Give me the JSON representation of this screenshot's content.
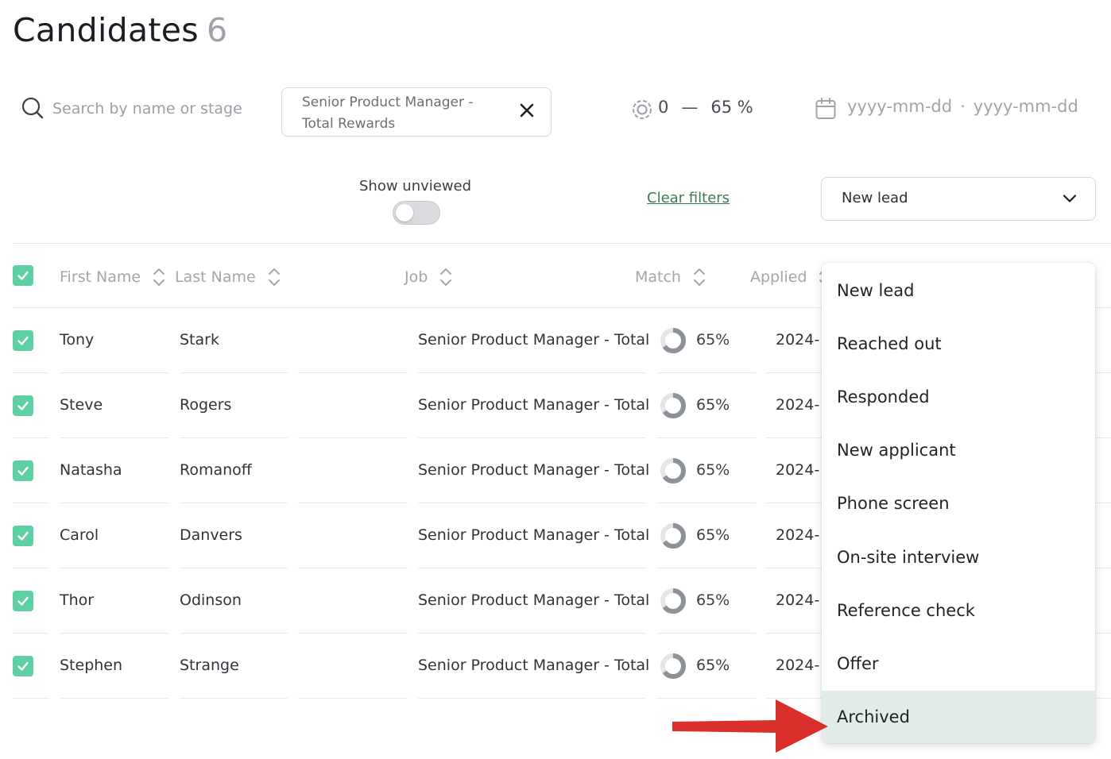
{
  "header": {
    "title": "Candidates",
    "count": "6"
  },
  "filters": {
    "search_placeholder": "Search by name or stage",
    "job_chip": "Senior Product Manager - Total Rewards",
    "match_min": "0",
    "match_dash": "—",
    "match_max": "65 %",
    "date_start_placeholder": "yyyy-mm-dd",
    "date_sep": "·",
    "date_end_placeholder": "yyyy-mm-dd",
    "show_unviewed_label": "Show unviewed",
    "show_unviewed_on": false,
    "clear_filters": "Clear filters",
    "stage_selected": "New lead"
  },
  "table": {
    "columns": [
      "First Name",
      "Last Name",
      "Job",
      "Match",
      "Applied"
    ],
    "rows": [
      {
        "first": "Tony",
        "last": "Stark",
        "job": "Senior Product Manager - Total",
        "match": "65%",
        "match_fraction": 0.65,
        "applied": "2024-"
      },
      {
        "first": "Steve",
        "last": "Rogers",
        "job": "Senior Product Manager - Total",
        "match": "65%",
        "match_fraction": 0.65,
        "applied": "2024-"
      },
      {
        "first": "Natasha",
        "last": "Romanoff",
        "job": "Senior Product Manager - Total",
        "match": "65%",
        "match_fraction": 0.65,
        "applied": "2024-"
      },
      {
        "first": "Carol",
        "last": "Danvers",
        "job": "Senior Product Manager - Total",
        "match": "65%",
        "match_fraction": 0.65,
        "applied": "2024-"
      },
      {
        "first": "Thor",
        "last": "Odinson",
        "job": "Senior Product Manager - Total",
        "match": "65%",
        "match_fraction": 0.65,
        "applied": "2024-"
      },
      {
        "first": "Stephen",
        "last": "Strange",
        "job": "Senior Product Manager - Total",
        "match": "65%",
        "match_fraction": 0.65,
        "applied": "2024-"
      }
    ]
  },
  "stage_menu": {
    "items": [
      "New lead",
      "Reached out",
      "Responded",
      "New applicant",
      "Phone screen",
      "On-site interview",
      "Reference check",
      "Offer",
      "Archived"
    ],
    "highlighted": "Archived"
  },
  "colors": {
    "checkbox": "#5fd0a4",
    "link": "#3e7a55",
    "highlight": "#e1ece8",
    "arrow": "#d9302c"
  }
}
